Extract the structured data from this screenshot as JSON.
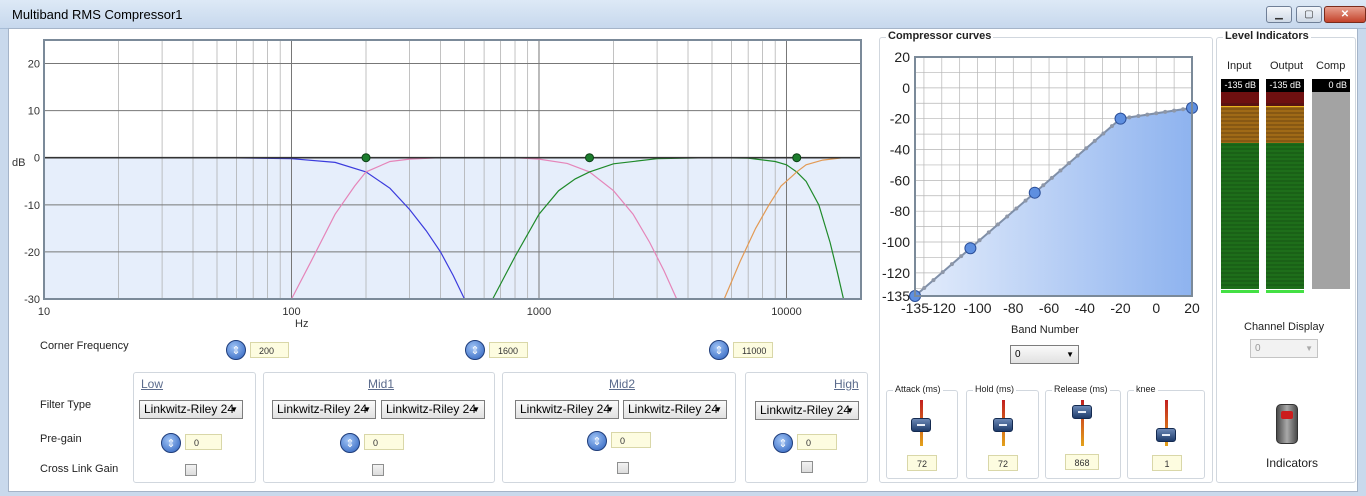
{
  "window": {
    "title": "Multiband RMS Compressor1",
    "minimize": "▁",
    "maximize": "▢",
    "close": "✕"
  },
  "eq": {
    "ylabel": "dB",
    "xlabel": "Hz",
    "y_ticks": [
      "20",
      "10",
      "0",
      "-10",
      "-20",
      "-30"
    ],
    "x_ticks": [
      "10",
      "100",
      "1000",
      "10000"
    ],
    "corner_label": "Corner Frequency",
    "corner_values": [
      "200",
      "1600",
      "11000"
    ]
  },
  "chart_data": {
    "type": "line",
    "xscale": "log",
    "xlim": [
      10,
      20000
    ],
    "ylim": [
      -30,
      25
    ],
    "xlabel": "Hz",
    "ylabel": "dB",
    "grid": true,
    "crossovers": [
      200,
      1600,
      11000
    ],
    "series": [
      {
        "color": "#3b3bdd",
        "x": [
          10,
          20,
          50,
          100,
          150,
          200,
          250,
          300,
          350,
          400,
          450,
          500
        ],
        "y": [
          0,
          0,
          0,
          -0.2,
          -1,
          -3,
          -6.5,
          -11,
          -15.5,
          -20,
          -25,
          -30
        ]
      },
      {
        "color": "#e585b9",
        "x": [
          100,
          120,
          150,
          180,
          200,
          250,
          300,
          400,
          600,
          800,
          1000,
          1300,
          1600,
          2000,
          2400,
          2800,
          3200,
          3600
        ],
        "y": [
          -30,
          -22,
          -12,
          -6,
          -3,
          -0.8,
          -0.3,
          0,
          0,
          0,
          -0.3,
          -1.2,
          -3,
          -7,
          -12,
          -18,
          -24,
          -30
        ]
      },
      {
        "color": "#1f8a2a",
        "x": [
          650,
          800,
          1000,
          1200,
          1400,
          1600,
          2000,
          3000,
          5000,
          7000,
          9000,
          10000,
          11000,
          12000,
          13500,
          15000,
          16000,
          17000
        ],
        "y": [
          -30,
          -21,
          -12,
          -7,
          -4.5,
          -3,
          -1.3,
          -0.2,
          0,
          -0.1,
          -0.8,
          -1.5,
          -3,
          -5,
          -10,
          -18,
          -24,
          -30
        ]
      },
      {
        "color": "#e29a55",
        "x": [
          5600,
          6500,
          7500,
          8500,
          9500,
          10500,
          11000,
          12000,
          14000,
          17000,
          20000
        ],
        "y": [
          -30,
          -22,
          -15,
          -10,
          -6,
          -4,
          -3,
          -1.5,
          -0.5,
          0,
          0
        ]
      },
      {
        "color": "#333333",
        "x": [
          10,
          200,
          1000,
          1600,
          3000,
          11000,
          20000
        ],
        "y": [
          0,
          0,
          0,
          0,
          0,
          0,
          0
        ]
      }
    ],
    "points": [
      {
        "x": 200,
        "y": 0
      },
      {
        "x": 1600,
        "y": 0
      },
      {
        "x": 11000,
        "y": 0
      }
    ]
  },
  "bands": {
    "filter_type_label": "Filter Type",
    "pregain_label": "Pre-gain",
    "crosslink_label": "Cross Link Gain",
    "low": {
      "name": "Low",
      "filter": "Linkwitz-Riley 24",
      "pregain": "0"
    },
    "mid1": {
      "name": "Mid1",
      "filter_a": "Linkwitz-Riley 24",
      "filter_b": "Linkwitz-Riley 24",
      "pregain": "0"
    },
    "mid2": {
      "name": "Mid2",
      "filter_a": "Linkwitz-Riley 24",
      "filter_b": "Linkwitz-Riley 24",
      "pregain": "0"
    },
    "high": {
      "name": "High",
      "filter": "Linkwitz-Riley 24",
      "pregain": "0"
    }
  },
  "compressor": {
    "title": "Compressor curves",
    "y_ticks": [
      "20",
      "0",
      "-20",
      "-40",
      "-60",
      "-80",
      "-100",
      "-120",
      "-135"
    ],
    "x_ticks": [
      "-135",
      "-120",
      "-100",
      "-80",
      "-60",
      "-40",
      "-20",
      "0",
      "20"
    ],
    "band_number_label": "Band Number",
    "band_number_value": "0",
    "curve": {
      "xlim": [
        -135,
        20
      ],
      "ylim": [
        -135,
        20
      ],
      "points": [
        [
          -135,
          -135
        ],
        [
          -104,
          -104
        ],
        [
          -68,
          -68
        ],
        [
          -20,
          -20
        ],
        [
          20,
          -13
        ]
      ],
      "handles": [
        [
          -135,
          -135
        ],
        [
          -104,
          -104
        ],
        [
          -68,
          -68
        ],
        [
          -20,
          -20
        ],
        [
          20,
          -13
        ]
      ]
    },
    "sliders": [
      {
        "label": "Attack (ms)",
        "value": "72",
        "level": 0.45
      },
      {
        "label": "Hold (ms)",
        "value": "72",
        "level": 0.45
      },
      {
        "label": "Release (ms)",
        "value": "868",
        "level": 0.75
      },
      {
        "label": "knee",
        "value": "1",
        "level": 0.25
      }
    ]
  },
  "levels": {
    "title": "Level Indicators",
    "meters": [
      {
        "label": "Input",
        "value": "-135 dB"
      },
      {
        "label": "Output",
        "value": "-135 dB"
      },
      {
        "label": "Comp",
        "value": "0 dB"
      }
    ],
    "channel_label": "Channel Display",
    "channel_value": "0",
    "indicators_label": "Indicators"
  },
  "colors": {
    "grid": "#a8a8a8",
    "fill": "#e6eefb",
    "curve_fill": "#8eb3ef",
    "handle": "#5e8fe0",
    "dot": "#1c7d2d"
  }
}
